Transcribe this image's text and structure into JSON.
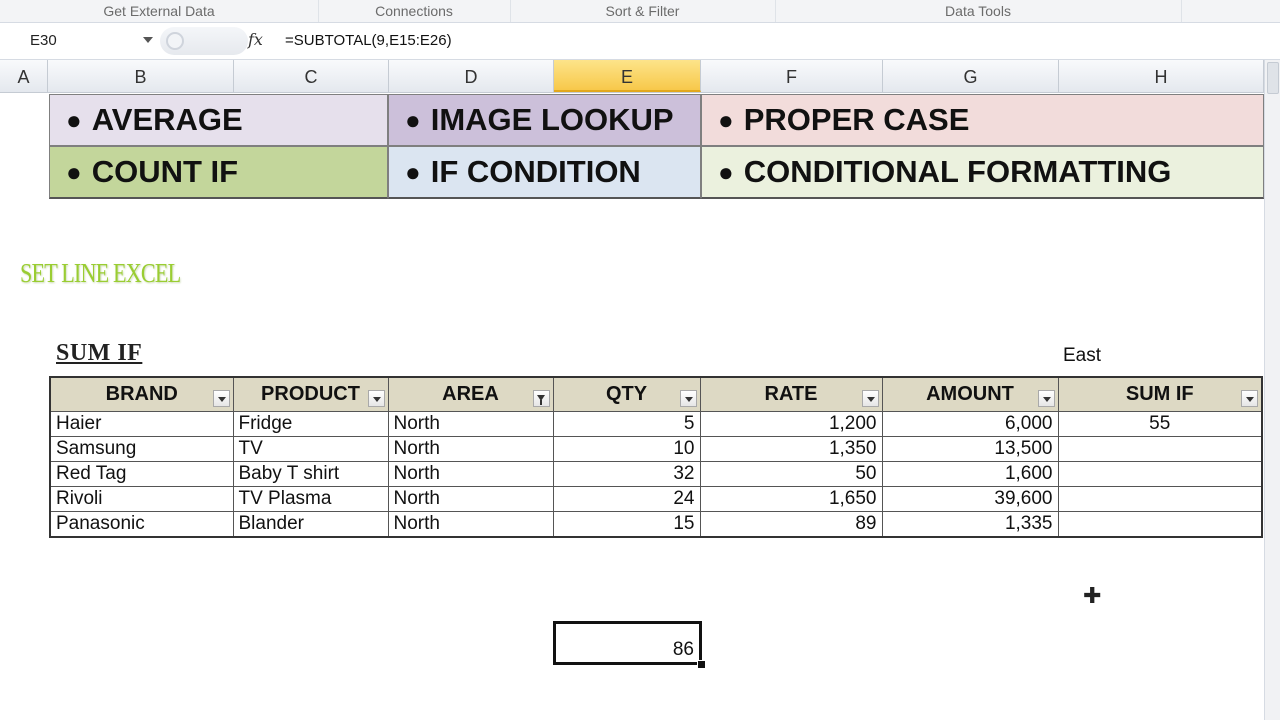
{
  "ribbon": {
    "groups": [
      "Get External Data",
      "Connections",
      "Sort & Filter",
      "Data Tools"
    ]
  },
  "formula_bar": {
    "name_box": "E30",
    "fx_label": "fx",
    "formula": "=SUBTOTAL(9,E15:E26)"
  },
  "columns": [
    "A",
    "B",
    "C",
    "D",
    "E",
    "F",
    "G",
    "H"
  ],
  "active_column": "E",
  "banner": [
    {
      "text": "AVERAGE",
      "color": "#e6e0ec"
    },
    {
      "text": "IMAGE LOOKUP",
      "color": "#ccc0da"
    },
    {
      "text": "PROPER CASE",
      "color": "#f2dcdb"
    },
    {
      "text": "COUNT IF",
      "color": "#c3d69b"
    },
    {
      "text": "IF CONDITION",
      "color": "#dbe5f1"
    },
    {
      "text": "CONDITIONAL FORMATTING",
      "color": "#ebf1de"
    }
  ],
  "set_line": "SET LINE EXCEL",
  "section_title": "SUM IF",
  "criteria": "East",
  "table": {
    "headers": [
      "BRAND",
      "PRODUCT",
      "AREA",
      "QTY",
      "RATE",
      "AMOUNT",
      "SUM IF"
    ],
    "filtered_column": "AREA",
    "rows": [
      [
        "Haier",
        "Fridge",
        "North",
        "5",
        "1,200",
        "6,000",
        "55"
      ],
      [
        "Samsung",
        "TV",
        "North",
        "10",
        "1,350",
        "13,500",
        ""
      ],
      [
        "Red Tag",
        "Baby T shirt",
        "North",
        "32",
        "50",
        "1,600",
        ""
      ],
      [
        "Rivoli",
        "TV Plasma",
        "North",
        "24",
        "1,650",
        "39,600",
        ""
      ],
      [
        "Panasonic",
        "Blander",
        "North",
        "15",
        "89",
        "1,335",
        ""
      ]
    ]
  },
  "selected_cell_value": "86"
}
